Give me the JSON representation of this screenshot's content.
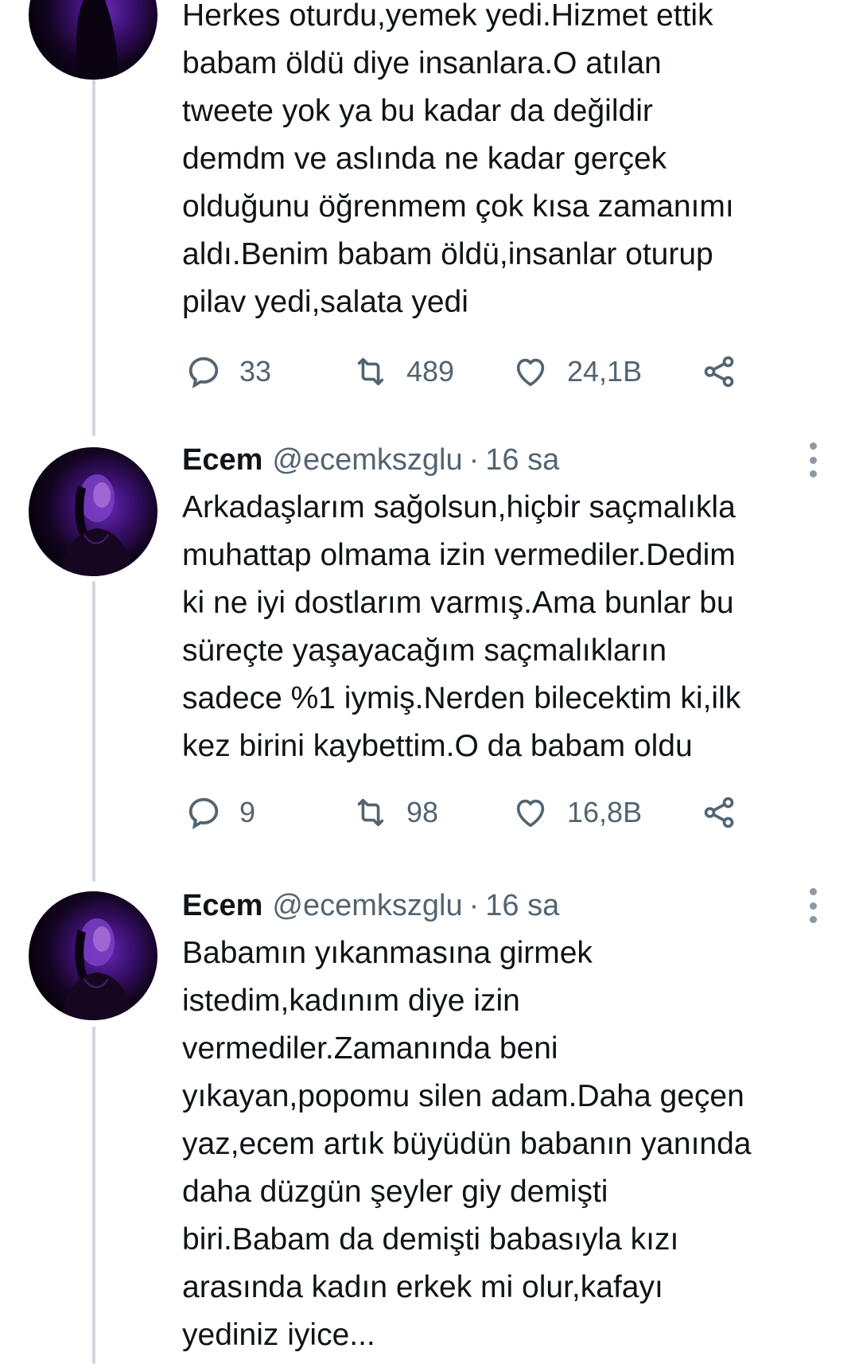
{
  "tweets": [
    {
      "text": "Herkes oturdu,yemek yedi.Hizmet ettik\nbabam öldü diye insanlara.O atılan\ntweete yok ya bu kadar da değildir\ndemdm ve aslında ne kadar gerçek\nolduğunu öğrenmem çok kısa zamanımı\naldı.Benim babam öldü,insanlar oturup\npilav yedi,salata yedi",
      "replies": "33",
      "retweets": "489",
      "likes": "24,1B"
    },
    {
      "name": "Ecem",
      "handle": "@ecemkszglu",
      "separator": "·",
      "time": "16 sa",
      "text": "Arkadaşlarım sağolsun,hiçbir saçmalıkla\nmuhattap olmama izin vermediler.Dedim\nki ne iyi dostlarım varmış.Ama bunlar bu\nsüreçte yaşayacağım saçmalıkların\nsadece %1 iymiş.Nerden bilecektim ki,ilk\nkez birini kaybettim.O da babam oldu",
      "replies": "9",
      "retweets": "98",
      "likes": "16,8B"
    },
    {
      "name": "Ecem",
      "handle": "@ecemkszglu",
      "separator": "·",
      "time": "16 sa",
      "text": "Babamın yıkanmasına girmek\nistedim,kadınım diye izin\nvermediler.Zamanında beni\nyıkayan,popomu silen adam.Daha geçen\nyaz,ecem artık büyüdün babanın yanında\ndaha düzgün şeyler giy demişti\nbiri.Babam da demişti babasıyla kızı\narasında kadın erkek mi olur,kafayı\nyediniz iyice..."
    }
  ],
  "icons": {
    "reply": "reply-icon",
    "retweet": "retweet-icon",
    "like": "heart-icon",
    "share": "share-icon",
    "more": "more-vertical-icon"
  },
  "colors": {
    "text": "#0f1419",
    "secondary": "#536471",
    "thread_line": "#cfd9de",
    "avatar_glow": "#6a2bb8"
  }
}
